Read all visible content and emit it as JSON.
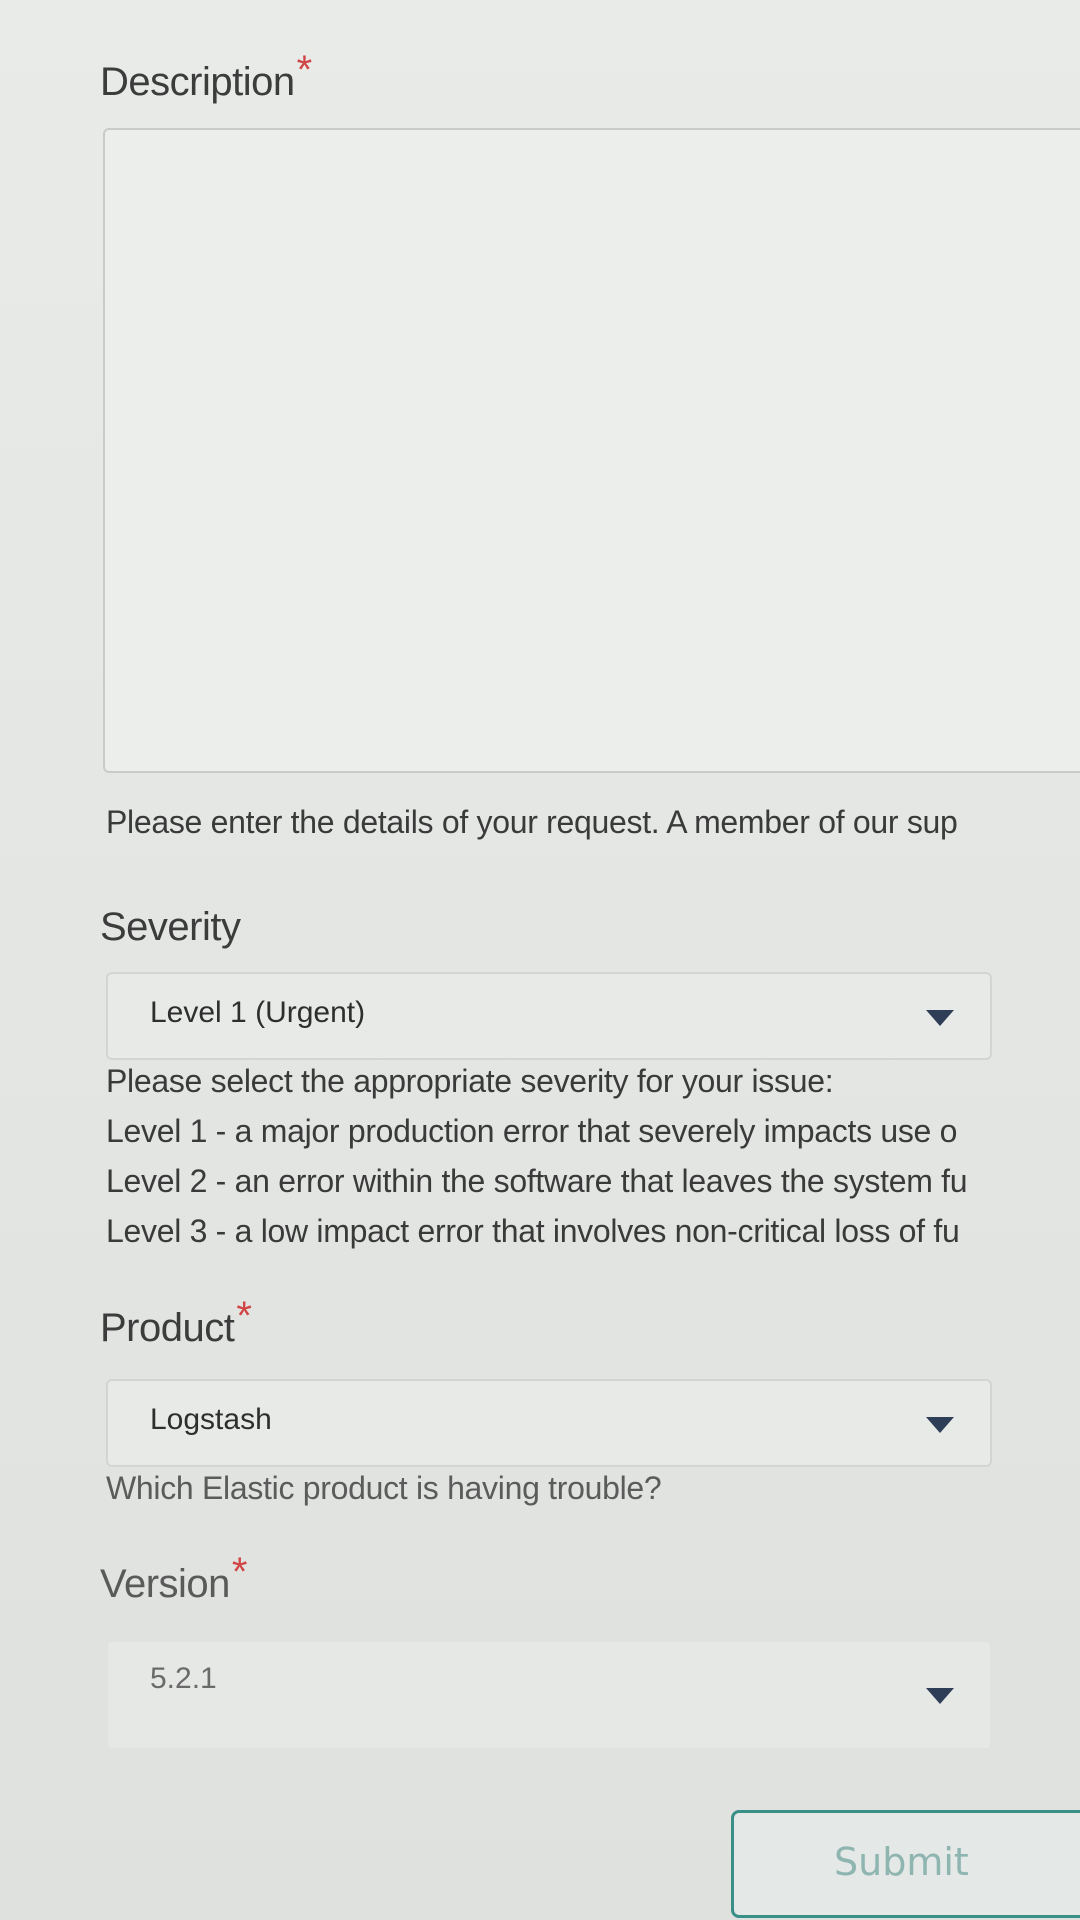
{
  "description": {
    "label": "Description",
    "required_mark": "*",
    "help": "Please enter the details of your request. A member of our sup"
  },
  "severity": {
    "label": "Severity",
    "selected": "Level 1 (Urgent)",
    "help_lines": [
      "Please select the appropriate severity for your issue:",
      "Level 1 - a major production error that severely impacts use o",
      "Level 2 - an error within the software that leaves the system fu",
      "Level 3 - a low impact error that involves non-critical loss of fu"
    ]
  },
  "product": {
    "label": "Product",
    "required_mark": "*",
    "selected": "Logstash",
    "help": "Which Elastic product is having trouble?"
  },
  "version": {
    "label": "Version",
    "required_mark": "*",
    "selected": "5.2.1"
  },
  "submit": {
    "label": "Submit"
  },
  "icons": {
    "dropdown": "chevron-down-icon"
  },
  "colors": {
    "required": "#d04545",
    "submit_border": "#3a8f88",
    "arrow": "#2f3e57"
  }
}
